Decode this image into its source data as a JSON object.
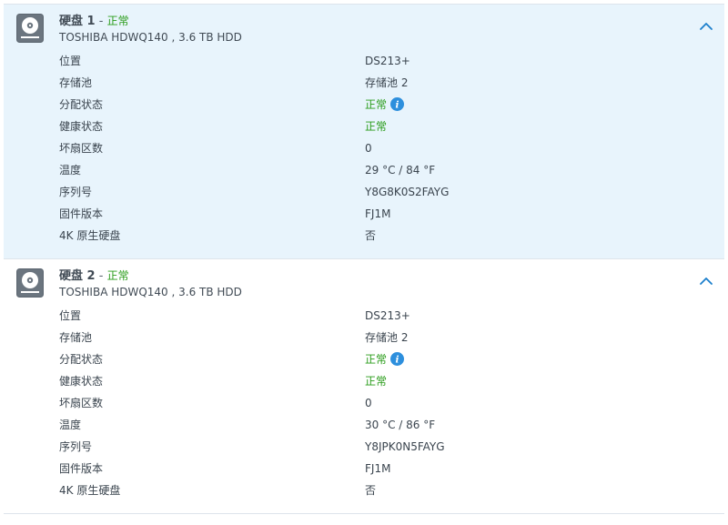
{
  "disks": [
    {
      "name": "硬盘 1",
      "separator": "-",
      "status": "正常",
      "model": "TOSHIBA HDWQ140 , 3.6 TB HDD",
      "icon": "hard-disk-icon",
      "toggle_icon": "chevron-up-icon",
      "highlighted": true,
      "rows": [
        {
          "label": "位置",
          "value": "DS213+"
        },
        {
          "label": "存储池",
          "value": "存储池 2"
        },
        {
          "label": "分配状态",
          "value": "正常",
          "status": "ok",
          "info": true
        },
        {
          "label": "健康状态",
          "value": "正常",
          "status": "ok"
        },
        {
          "label": "坏扇区数",
          "value": "0"
        },
        {
          "label": "温度",
          "value": "29 °C / 84 °F"
        },
        {
          "label": "序列号",
          "value": "Y8G8K0S2FAYG"
        },
        {
          "label": "固件版本",
          "value": "FJ1M"
        },
        {
          "label": "4K 原生硬盘",
          "value": "否"
        }
      ]
    },
    {
      "name": "硬盘 2",
      "separator": "-",
      "status": "正常",
      "model": "TOSHIBA HDWQ140 , 3.6 TB HDD",
      "icon": "hard-disk-icon",
      "toggle_icon": "chevron-up-icon",
      "highlighted": false,
      "rows": [
        {
          "label": "位置",
          "value": "DS213+"
        },
        {
          "label": "存储池",
          "value": "存储池 2"
        },
        {
          "label": "分配状态",
          "value": "正常",
          "status": "ok",
          "info": true
        },
        {
          "label": "健康状态",
          "value": "正常",
          "status": "ok"
        },
        {
          "label": "坏扇区数",
          "value": "0"
        },
        {
          "label": "温度",
          "value": "30 °C / 86 °F"
        },
        {
          "label": "序列号",
          "value": "Y8JPK0N5FAYG"
        },
        {
          "label": "固件版本",
          "value": "FJ1M"
        },
        {
          "label": "4K 原生硬盘",
          "value": "否"
        }
      ]
    }
  ],
  "colors": {
    "highlight_bg": "#e8f4fc",
    "ok_status": "#2a9c1a",
    "chevron": "#1b7fcc",
    "info_icon": "#2d8fdd"
  }
}
